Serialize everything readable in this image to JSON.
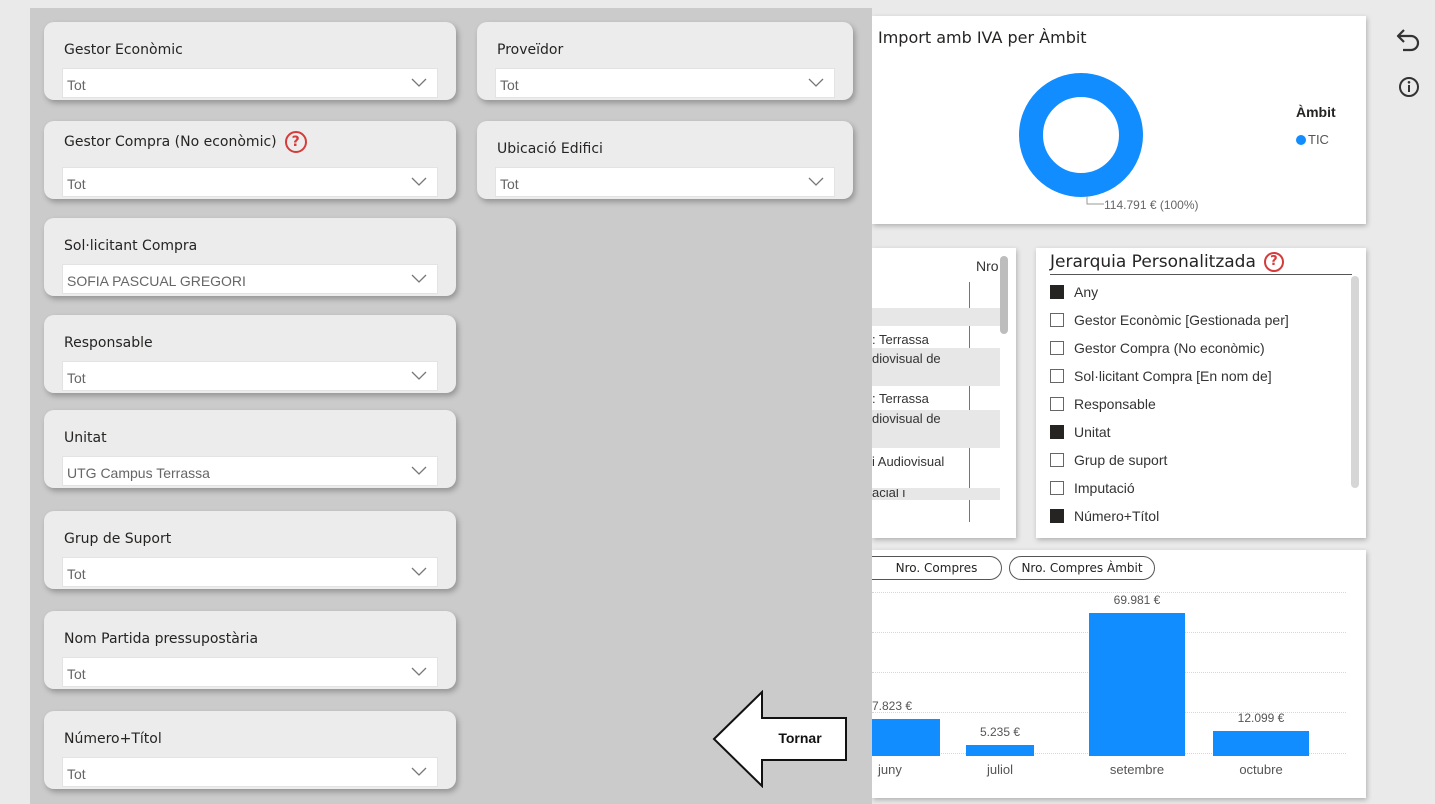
{
  "slicers_left": [
    {
      "title": "Gestor Econòmic",
      "value": "Tot"
    },
    {
      "title": "Gestor Compra (No econòmic)",
      "value": "Tot",
      "help": "?"
    },
    {
      "title": "Sol·licitant Compra",
      "value": "SOFIA PASCUAL GREGORI"
    },
    {
      "title": "Responsable",
      "value": "Tot"
    },
    {
      "title": "Unitat",
      "value": "UTG Campus Terrassa"
    },
    {
      "title": "Grup de Suport",
      "value": "Tot"
    },
    {
      "title": "Nom Partida pressupostària",
      "value": "Tot"
    },
    {
      "title": "Número+Títol",
      "value": "Tot"
    }
  ],
  "slicers_right": [
    {
      "title": "Proveïdor",
      "value": "Tot"
    },
    {
      "title": "Ubicació Edifici",
      "value": "Tot"
    }
  ],
  "back_button": {
    "label": "Tornar"
  },
  "donut": {
    "title": "Import amb IVA per Àmbit",
    "legend_title": "Àmbit",
    "legend_item": "TIC",
    "label": "114.791 € (100%)",
    "color": "#118dff"
  },
  "table": {
    "header": "Nro",
    "rows": [
      ": Terrassa",
      "diovisual de",
      ": Terrassa",
      "diovisual de",
      "i Audiovisual",
      "acial i"
    ]
  },
  "hierarchy": {
    "title": "Jerarquia Personalitzada",
    "help": "?",
    "items": [
      {
        "label": "Any",
        "checked": true
      },
      {
        "label": "Gestor Econòmic [Gestionada per]",
        "checked": false
      },
      {
        "label": "Gestor Compra (No econòmic)",
        "checked": false
      },
      {
        "label": "Sol·licitant Compra [En nom de]",
        "checked": false
      },
      {
        "label": "Responsable",
        "checked": false
      },
      {
        "label": "Unitat",
        "checked": true
      },
      {
        "label": "Grup de suport",
        "checked": false
      },
      {
        "label": "Imputació",
        "checked": false
      },
      {
        "label": "Número+Títol",
        "checked": true
      }
    ]
  },
  "bar_tabs": [
    "Nro. Compres",
    "Nro. Compres Àmbit"
  ],
  "chart_data": {
    "type": "bar",
    "categories": [
      "juny",
      "juliol",
      "setembre",
      "octubre"
    ],
    "values": [
      17823,
      5235,
      69981,
      12099
    ],
    "data_labels": [
      "7.823 €",
      "5.235 €",
      "69.981 €",
      "12.099 €"
    ],
    "ylim": [
      0,
      80000
    ],
    "color": "#118dff"
  },
  "top_icons": [
    "undo-icon",
    "info-icon"
  ]
}
